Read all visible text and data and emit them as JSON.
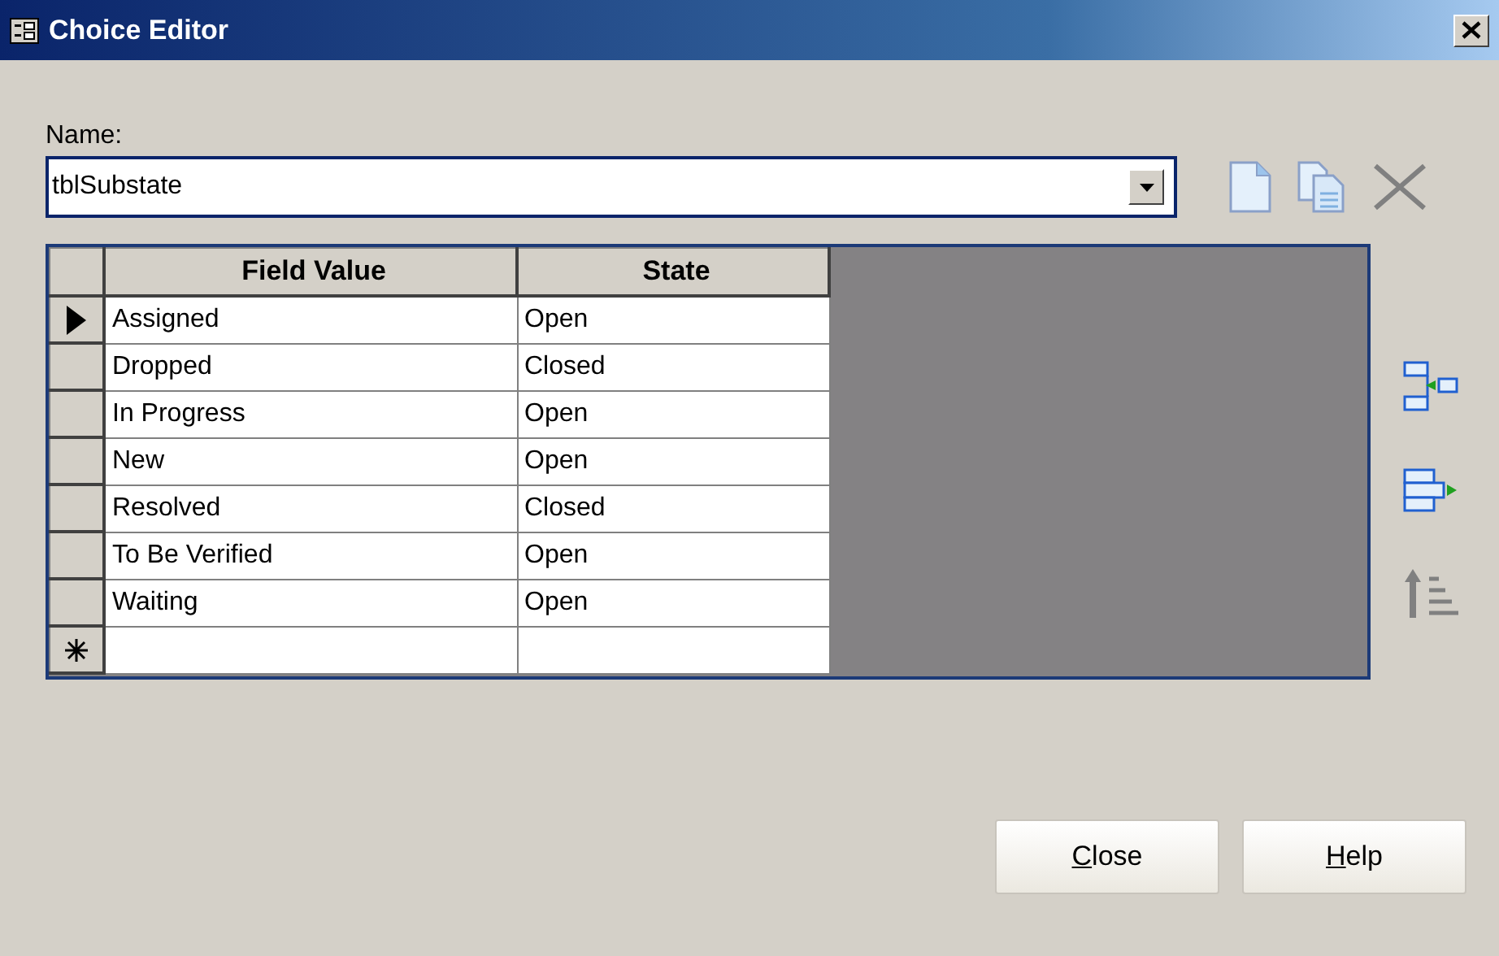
{
  "window": {
    "title": "Choice Editor"
  },
  "name_field": {
    "label": "Name:",
    "value": "tblSubstate"
  },
  "grid": {
    "columns": [
      "Field Value",
      "State"
    ],
    "rows": [
      {
        "field_value": "Assigned",
        "state": "Open",
        "selected": true
      },
      {
        "field_value": "Dropped",
        "state": "Closed",
        "selected": false
      },
      {
        "field_value": "In Progress",
        "state": "Open",
        "selected": false
      },
      {
        "field_value": "New",
        "state": "Open",
        "selected": false
      },
      {
        "field_value": "Resolved",
        "state": "Closed",
        "selected": false
      },
      {
        "field_value": "To Be Verified",
        "state": "Open",
        "selected": false
      },
      {
        "field_value": "Waiting",
        "state": "Open",
        "selected": false
      }
    ],
    "new_row": true
  },
  "buttons": [
    {
      "label": "Close"
    },
    {
      "label": "Help"
    }
  ]
}
